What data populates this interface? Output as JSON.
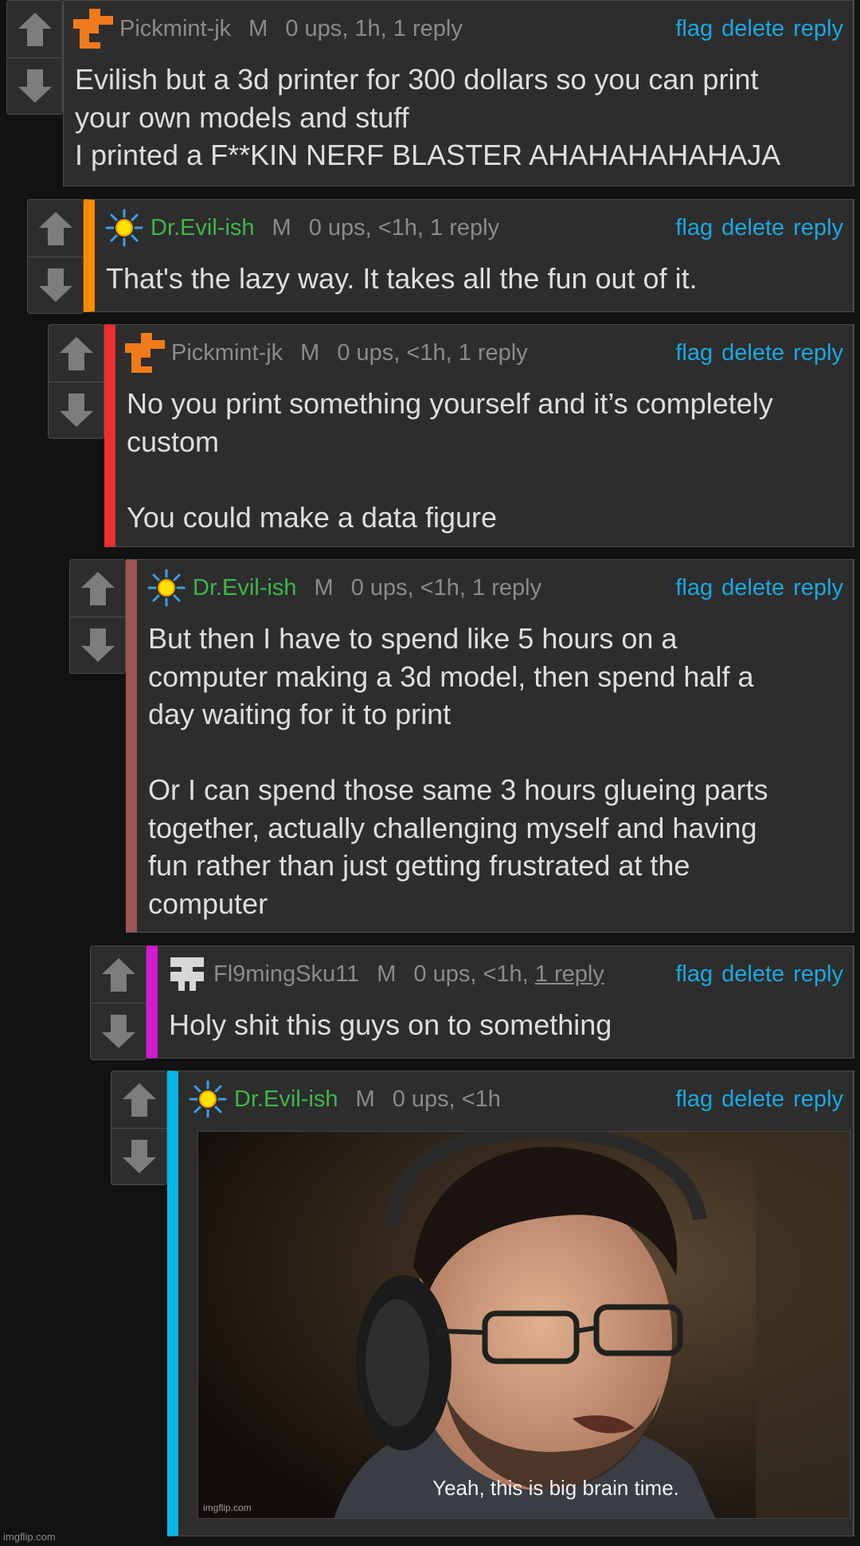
{
  "actions": {
    "flag": "flag",
    "delete": "delete",
    "reply": "reply"
  },
  "icons": {
    "upvote": "up-arrow-icon",
    "downvote": "down-arrow-icon"
  },
  "colors": {
    "background": "#121212",
    "panel": "#2d2d2d",
    "border": "#4b4b4b",
    "link": "#1aa9e2",
    "username_mod": "#3fb64a",
    "thread_bars": [
      "#ff8c00",
      "#ee2f2f",
      "#9c5555",
      "#d21ad2",
      "#06b6e8"
    ]
  },
  "comments": [
    {
      "user": "Pickmint-jk",
      "badge": "M",
      "stats": "0 ups, 1h, 1 reply",
      "avatar": "orange-pixel-avatar-icon",
      "lines": [
        "Evilish but a 3d printer for 300 dollars so you can print",
        "your own models and stuff",
        "I printed a F**KIN NERF BLASTER AHAHAHAHAHAJA"
      ]
    },
    {
      "user": "Dr.Evil-ish",
      "badge": "M",
      "stats": "0 ups, <1h, 1 reply",
      "avatar": "sun-avatar-icon",
      "lines": [
        "That's the lazy way. It takes all the fun out of it."
      ]
    },
    {
      "user": "Pickmint-jk",
      "badge": "M",
      "stats": "0 ups, <1h, 1 reply",
      "avatar": "orange-pixel-avatar-icon",
      "lines": [
        "No you print something yourself and it’s completely",
        "custom",
        "",
        "You could make a data figure"
      ]
    },
    {
      "user": "Dr.Evil-ish",
      "badge": "M",
      "stats": "0 ups, <1h, 1 reply",
      "avatar": "sun-avatar-icon",
      "lines": [
        "But then I have to spend like 5 hours on a",
        "computer making a 3d model, then spend half a",
        "day waiting for it to print",
        "",
        "Or I can spend those same 3 hours glueing parts",
        "together, actually challenging myself and having",
        "fun rather than just getting frustrated at the",
        "computer"
      ]
    },
    {
      "user": "Fl9mingSku11",
      "badge": "M",
      "stats_prefix": "0 ups, <1h, ",
      "stats_link": "1 reply",
      "avatar": "gray-pixel-avatar-icon",
      "lines": [
        "Holy shit this guys on to something"
      ]
    },
    {
      "user": "Dr.Evil-ish",
      "badge": "M",
      "stats": "0 ups, <1h",
      "avatar": "sun-avatar-icon",
      "meme": {
        "caption": "Yeah, this is big brain time.",
        "watermark": "imgflip.com"
      }
    }
  ],
  "site_watermark": "imgflip.com"
}
